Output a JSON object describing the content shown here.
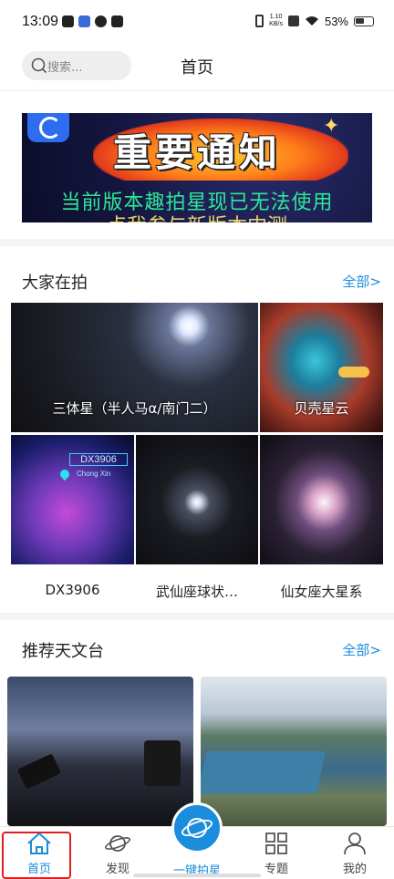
{
  "status_bar": {
    "time": "13:09",
    "net_speed_value": "1.10",
    "net_speed_unit": "KB/s",
    "battery": "53%"
  },
  "header": {
    "search_placeholder": "搜索...",
    "title": "首页"
  },
  "banner": {
    "title": "重要通知",
    "subtitle": "当前版本趣拍星现已无法使用",
    "subtitle_cut": "点我参与新版本内测"
  },
  "popular": {
    "title": "大家在拍",
    "more": "全部>",
    "items": [
      {
        "caption": "三体星（半人马α/南门二）"
      },
      {
        "caption": "贝壳星云"
      },
      {
        "caption": "DX3906",
        "overlay_label": "DX3906",
        "overlay_location": "Chong Xin"
      },
      {
        "caption": "武仙座球状…"
      },
      {
        "caption": "仙女座大星系"
      }
    ]
  },
  "observatories": {
    "title": "推荐天文台",
    "more": "全部>"
  },
  "tab_bar": {
    "items": [
      {
        "label": "首页",
        "icon": "home-icon",
        "active": true
      },
      {
        "label": "发现",
        "icon": "planet-icon",
        "active": false
      },
      {
        "label": "一键拍星",
        "icon": "camera-planet-icon",
        "active": false
      },
      {
        "label": "专题",
        "icon": "grid-icon",
        "active": false
      },
      {
        "label": "我的",
        "icon": "user-icon",
        "active": false
      }
    ]
  },
  "colors": {
    "accent": "#1a8ddd",
    "highlight": "#e02020"
  }
}
